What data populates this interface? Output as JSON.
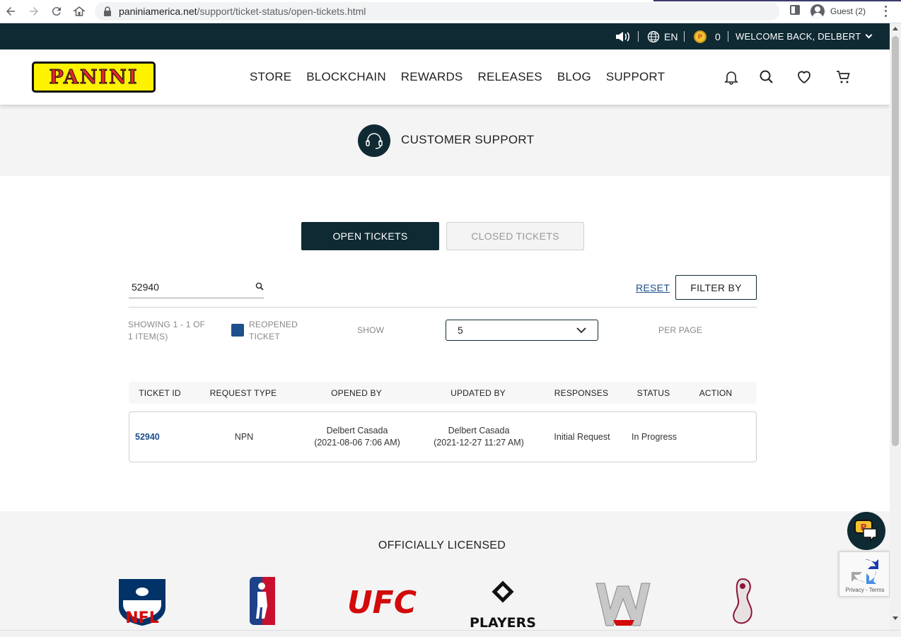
{
  "browser": {
    "url_host": "paniniamerica.net",
    "url_path": "/support/ticket-status/open-tickets.html",
    "profile_label": "Guest (2)"
  },
  "utility_bar": {
    "language": "EN",
    "points": "0",
    "welcome": "WELCOME BACK, DELBERT"
  },
  "header": {
    "logo_text": "PANINI",
    "nav": [
      "STORE",
      "BLOCKCHAIN",
      "REWARDS",
      "RELEASES",
      "BLOG",
      "SUPPORT"
    ]
  },
  "banner": {
    "title": "CUSTOMER SUPPORT"
  },
  "tabs": {
    "open": "OPEN TICKETS",
    "closed": "CLOSED TICKETS"
  },
  "search": {
    "value": "52940"
  },
  "controls": {
    "reset": "RESET",
    "filter": "FILTER BY",
    "showing_line1": "SHOWING 1 - 1 OF",
    "showing_line2": "1 ITEM(S)",
    "legend_line1": "REOPENED",
    "legend_line2": "TICKET",
    "show_label": "SHOW",
    "page_size": "5",
    "per_page": "PER PAGE"
  },
  "table": {
    "headers": [
      "TICKET ID",
      "REQUEST TYPE",
      "OPENED BY",
      "UPDATED BY",
      "RESPONSES",
      "STATUS",
      "ACTION"
    ],
    "rows": [
      {
        "ticket_id": "52940",
        "request_type": "NPN",
        "opened_by_name": "Delbert Casada",
        "opened_by_date": "(2021-08-06 7:06 AM)",
        "updated_by_name": "Delbert Casada",
        "updated_by_date": "(2021-12-27 11:27 AM)",
        "responses": "Initial Request",
        "status": "In Progress",
        "action": ""
      }
    ]
  },
  "footer": {
    "title": "OFFICIALLY LICENSED",
    "logos": [
      "NFL",
      "NBA",
      "UFC",
      "PLAYERS",
      "WWE",
      "FIFA World Cup"
    ],
    "nfl_text": "NFL",
    "ufc_text": "UFC",
    "players_text": "PLAYERS"
  },
  "recaptcha": {
    "text": "Privacy - Terms"
  },
  "chat": {
    "badge": "P"
  },
  "colors": {
    "brand_dark": "#0f2a33",
    "link_blue": "#1c4f8c",
    "logo_yellow": "#fff200",
    "logo_red": "#e3262c"
  }
}
